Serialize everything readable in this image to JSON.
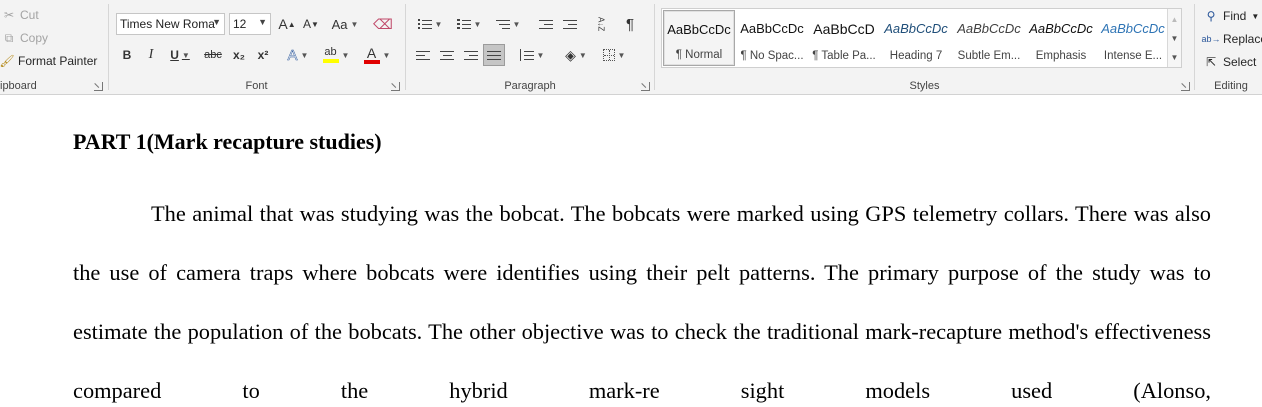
{
  "ribbon": {
    "clipboard": {
      "label": "ipboard",
      "cut": "Cut",
      "copy": "Copy",
      "format_painter": "Format Painter"
    },
    "font": {
      "label": "Font",
      "font_name": "Times New Roma",
      "font_size": "12",
      "grow": "A",
      "shrink": "A",
      "change_case": "Aa",
      "bold": "B",
      "italic": "I",
      "underline": "U",
      "strikethrough": "abc",
      "subscript": "x₂",
      "superscript": "x²",
      "text_effects": "A",
      "highlight": "ab",
      "font_color": "A"
    },
    "paragraph": {
      "label": "Paragraph",
      "show_marks": "¶",
      "sort": "A↓Z"
    },
    "styles": {
      "label": "Styles",
      "items": [
        {
          "sample": "AaBbCcDc",
          "name": "¶ Normal"
        },
        {
          "sample": "AaBbCcDc",
          "name": "¶ No Spac..."
        },
        {
          "sample": "AaBbCcD",
          "name": "¶ Table Pa..."
        },
        {
          "sample": "AaBbCcDc",
          "name": "Heading 7"
        },
        {
          "sample": "AaBbCcDc",
          "name": "Subtle Em..."
        },
        {
          "sample": "AaBbCcDc",
          "name": "Emphasis"
        },
        {
          "sample": "AaBbCcDc",
          "name": "Intense E..."
        }
      ]
    },
    "editing": {
      "label": "Editing",
      "find": "Find",
      "replace": "Replace",
      "select": "Select"
    }
  },
  "document": {
    "heading": "PART 1(Mark recapture studies)",
    "paragraph": "The animal that was studying was the bobcat. The bobcats were marked using GPS telemetry collars. There was also the use of camera traps where bobcats were identifies using their pelt patterns. The primary purpose of the study was to estimate the population of the bobcats. The other objective was to check the traditional mark-recapture method's effectiveness compared to the hybrid mark-re sight models used (Alonso,"
  },
  "colors": {
    "ribbon_bg": "#f3f3f3",
    "highlight_yellow": "#ffff00",
    "font_color_red": "#e00000",
    "text_effects_blue": "#2b579a",
    "italic_style_blue": "#1f4e79"
  }
}
